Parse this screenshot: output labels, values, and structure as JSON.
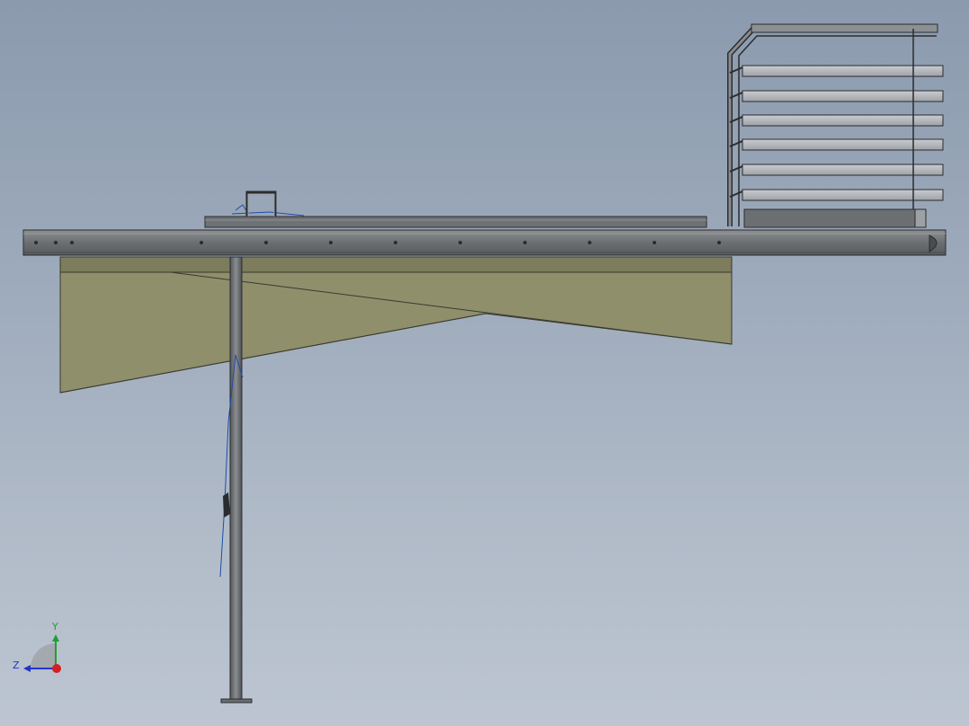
{
  "colors": {
    "steel_dark": "#5a5d60",
    "steel_mid": "#74777a",
    "steel_light": "#a2a5a8",
    "panel_fill": "#8f8f6c",
    "panel_fill_dark": "#7d7c5c",
    "edge": "#2b2c2e",
    "blue_line": "#1d4ea8",
    "axis_x": "#d42020",
    "axis_y": "#1f9f2f",
    "axis_z": "#2036c8"
  },
  "triad": {
    "y_label": "Y",
    "z_label": "Z"
  },
  "icons": {
    "triad": "coordinate-triad-icon"
  }
}
